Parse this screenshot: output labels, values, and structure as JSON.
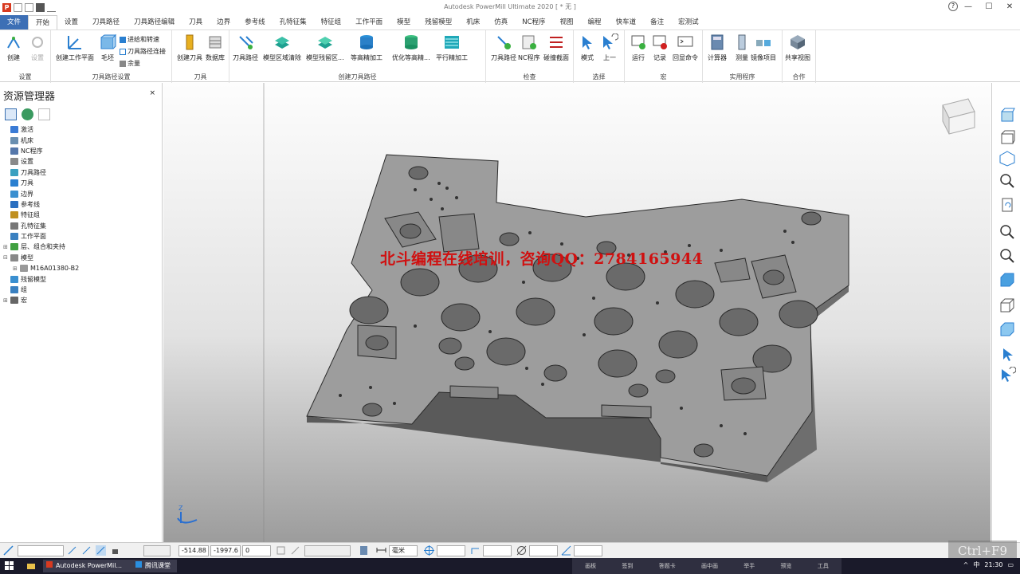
{
  "window": {
    "title": "Autodesk PowerMill Ultimate 2020   [ * 无 ]",
    "help_glyph": "?",
    "controls": [
      "—",
      "☐",
      "✕"
    ]
  },
  "ribbon_tabs": [
    {
      "label": "文件",
      "type": "file"
    },
    {
      "label": "开始",
      "type": "active"
    },
    {
      "label": "设置"
    },
    {
      "label": "刀具路径"
    },
    {
      "label": "刀具路径编辑"
    },
    {
      "label": "刀具"
    },
    {
      "label": "边界"
    },
    {
      "label": "参考线"
    },
    {
      "label": "孔特征集"
    },
    {
      "label": "特征组"
    },
    {
      "label": "工作平面"
    },
    {
      "label": "模型"
    },
    {
      "label": "残留模型"
    },
    {
      "label": "机床"
    },
    {
      "label": "仿真"
    },
    {
      "label": "NC程序"
    },
    {
      "label": "视图"
    },
    {
      "label": "编程"
    },
    {
      "label": "快车道"
    },
    {
      "label": "备注"
    },
    {
      "label": "宏测试"
    }
  ],
  "ribbon": {
    "setup": {
      "caption": "设置",
      "create": "创建",
      "settings": "设置"
    },
    "toolpath_setup": {
      "caption": "刀具路径设置",
      "workplane": "创建工作平面",
      "stock": "毛坯",
      "feeds": "进给和转速",
      "connections": "刀具路径连接",
      "allowance": "余量"
    },
    "tool": {
      "caption": "刀具",
      "create_tool": "创建刀具",
      "database": "数据库"
    },
    "create_toolpath": {
      "caption": "创建刀具路径",
      "buttons": [
        "刀具路径",
        "模型区域清除",
        "模型残留区...",
        "等高精加工",
        "优化等高精...",
        "平行精加工"
      ]
    },
    "verify": {
      "caption": "检查",
      "buttons": [
        "刀具路径",
        "NC程序",
        "碰撞截面"
      ]
    },
    "select": {
      "caption": "选择",
      "buttons": [
        "模式",
        "上一"
      ]
    },
    "macro": {
      "caption": "宏",
      "buttons": [
        "运行",
        "记录",
        "回显命令"
      ]
    },
    "utilities": {
      "caption": "实用程序",
      "buttons": [
        "计算器",
        "测量",
        "镜像项目"
      ]
    },
    "collaborate": {
      "caption": "合作",
      "buttons": [
        "共享视图"
      ]
    }
  },
  "explorer": {
    "title": "资源管理器",
    "close": "×",
    "items": [
      {
        "label": "激活",
        "icon": "activate-icon",
        "color": "#3a7bd5"
      },
      {
        "label": "机床",
        "icon": "machine-icon",
        "color": "#6a8fb0"
      },
      {
        "label": "NC程序",
        "icon": "nc-program-icon",
        "color": "#5577aa"
      },
      {
        "label": "设置",
        "icon": "setup-icon",
        "color": "#8a8a8a"
      },
      {
        "label": "刀具路径",
        "icon": "toolpath-icon",
        "color": "#3aa0c0"
      },
      {
        "label": "刀具",
        "icon": "tool-icon",
        "color": "#2a7fd0"
      },
      {
        "label": "边界",
        "icon": "boundary-icon",
        "color": "#3a8fd0"
      },
      {
        "label": "参考线",
        "icon": "pattern-icon",
        "color": "#2a6fc0"
      },
      {
        "label": "特征组",
        "icon": "feature-group-icon",
        "color": "#c09020"
      },
      {
        "label": "孔特征集",
        "icon": "hole-featureset-icon",
        "color": "#777777"
      },
      {
        "label": "工作平面",
        "icon": "workplane-icon",
        "color": "#3a80c0"
      },
      {
        "label": "层、组合和夹持",
        "icon": "levels-icon",
        "color": "#40a040"
      },
      {
        "label": "模型",
        "icon": "model-icon",
        "color": "#888888"
      },
      {
        "label": "M16A01380-B2",
        "icon": "model-item-icon",
        "color": "#999999"
      },
      {
        "label": "残留模型",
        "icon": "stock-model-icon",
        "color": "#3a8fd0"
      },
      {
        "label": "组",
        "icon": "group-icon",
        "color": "#3a80c0"
      },
      {
        "label": "宏",
        "icon": "macro-icon",
        "color": "#666666"
      }
    ]
  },
  "viewport": {
    "watermark": "北斗编程在线培训，咨询QQ：2784165944",
    "axis_label": "Z"
  },
  "statusbar": {
    "coord_x": "-514.88",
    "coord_y": "-1997.6",
    "coord_z": "0",
    "units": "毫米",
    "hint": "Ctrl+F9"
  },
  "taskbar": {
    "apps": [
      "Autodesk PowerMil...",
      "腾讯课堂"
    ],
    "menu": [
      "画板",
      "签到",
      "答题卡",
      "画中画",
      "举手",
      "预览",
      "工具"
    ],
    "time": "21:30",
    "ime": "中"
  }
}
